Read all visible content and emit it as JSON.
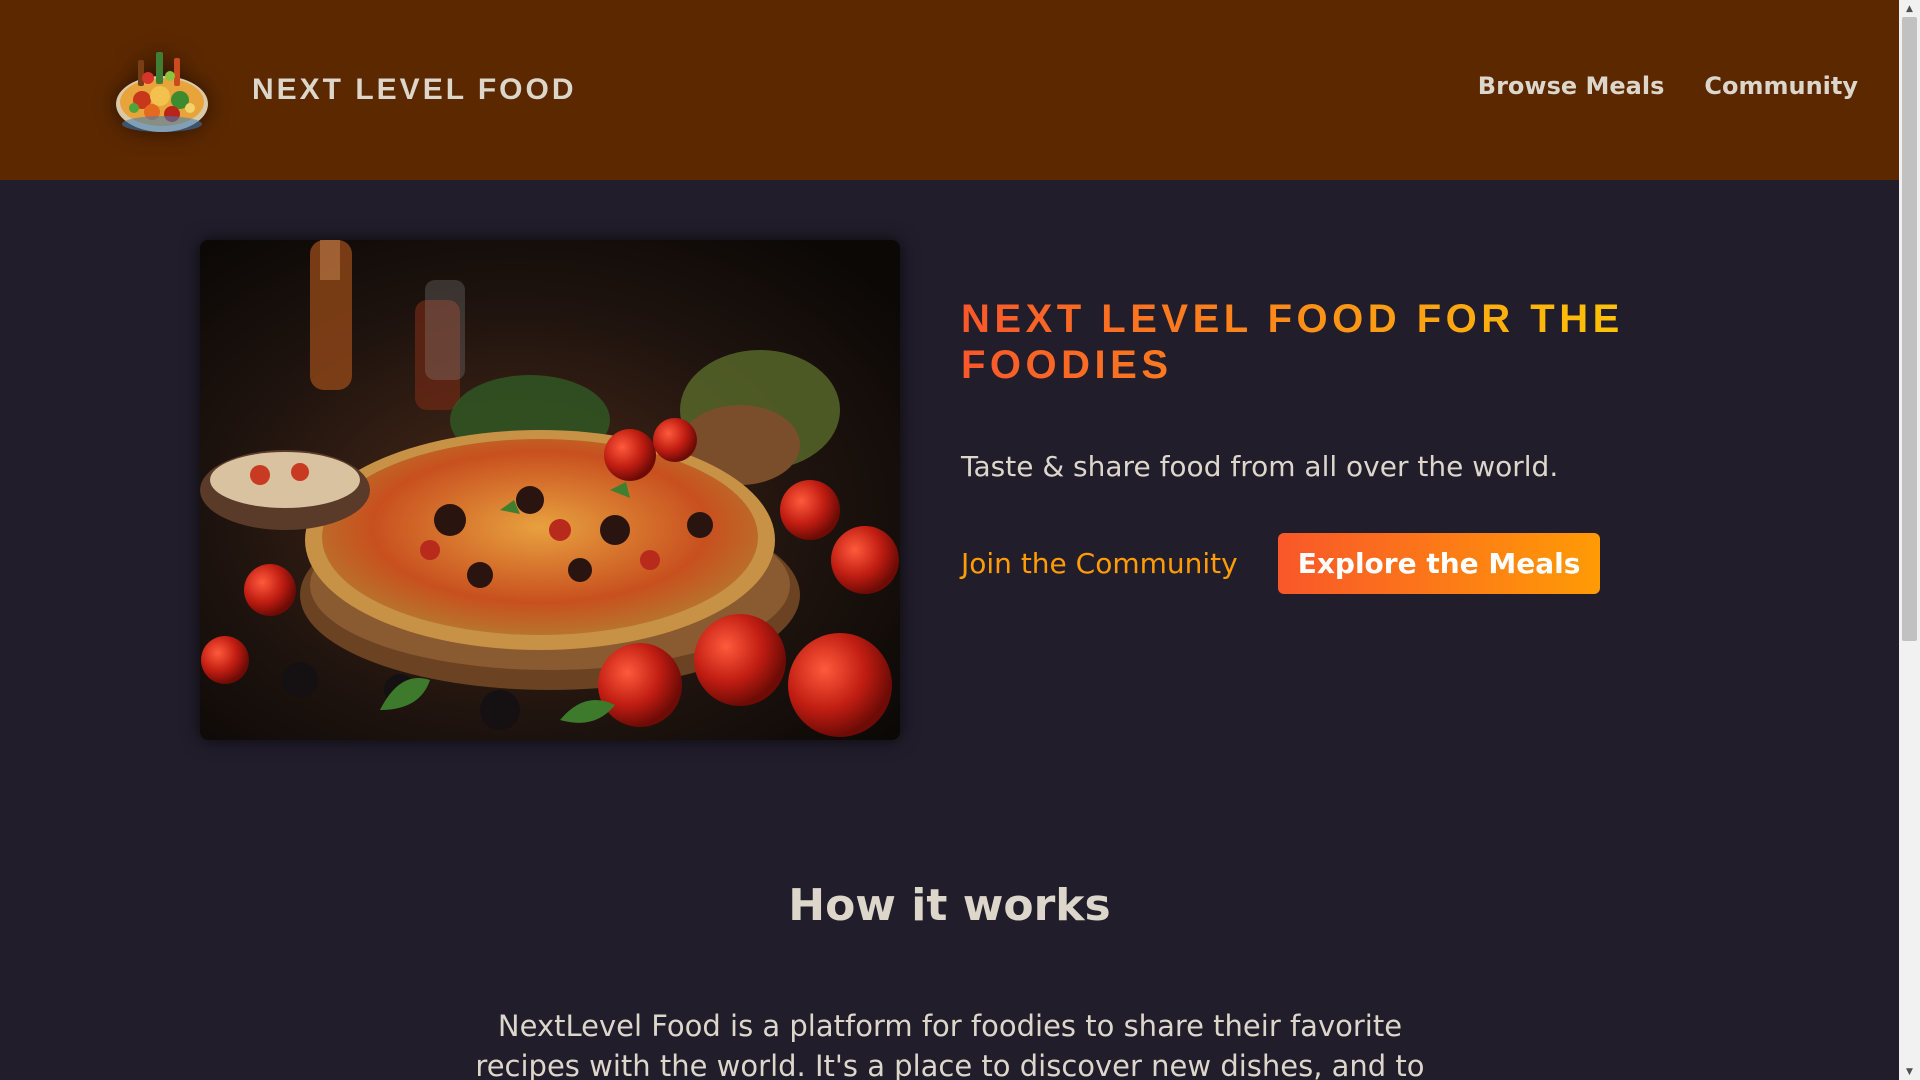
{
  "header": {
    "logo_text": "NEXT LEVEL FOOD",
    "nav": [
      {
        "label": "Browse Meals"
      },
      {
        "label": "Community"
      }
    ]
  },
  "hero": {
    "title": "NEXT LEVEL FOOD FOR THE FOODIES",
    "subtitle": "Taste & share food from all over the world.",
    "community_link": "Join the Community",
    "explore_button": "Explore the Meals"
  },
  "how_it_works": {
    "title": "How it works",
    "text": "NextLevel Food is a platform for foodies to share their favorite recipes with the world. It's a place to discover new dishes, and to connect with"
  },
  "scrollbar": {
    "up_icon": "chevron-up-icon",
    "down_icon": "chevron-down-icon"
  },
  "colors": {
    "header_bg": "#5b2800",
    "page_bg": "#221d2b",
    "accent_start": "#f9572a",
    "accent_end": "#ff9b05",
    "text": "#ddd6cb"
  }
}
